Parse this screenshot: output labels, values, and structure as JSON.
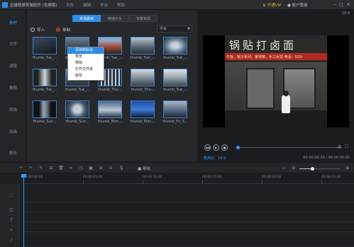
{
  "titlebar": {
    "title": "迅捷视频剪辑软件 (免费版)",
    "menus": [
      "文件",
      "编辑",
      "导出",
      "帮助"
    ],
    "vip_label": "开通VIP",
    "account_label": "账户登录",
    "icons": [
      "app-icon",
      "minimize-icon",
      "maximize-icon",
      "close-icon"
    ]
  },
  "sidebar": {
    "items": [
      {
        "label": "素材",
        "active": true
      },
      {
        "label": "文字",
        "active": false
      },
      {
        "label": "滤镜",
        "active": false
      },
      {
        "label": "叠附",
        "active": false
      },
      {
        "label": "转场",
        "active": false
      },
      {
        "label": "动画",
        "active": false
      },
      {
        "label": "配乐",
        "active": false
      }
    ]
  },
  "media": {
    "tabs": [
      {
        "label": "本地素材",
        "active": true
      },
      {
        "label": "精选片头",
        "active": false
      },
      {
        "label": "背景资源",
        "active": false
      }
    ],
    "import_label": "导入",
    "record_label": "录制",
    "filter_value": "所有",
    "thumbnails": [
      {
        "label": "thumb_Tue_..."
      },
      {
        "label": "thumb_Wed..."
      },
      {
        "label": "thumb_Tue_..."
      },
      {
        "label": "thumb_Tue_..."
      },
      {
        "label": "thumb_Tue_..."
      },
      {
        "label": "thumb_Tue_..."
      },
      {
        "label": "thumb_Tue_..."
      },
      {
        "label": "thumb_Thu..."
      },
      {
        "label": "thumb_Thu..."
      },
      {
        "label": "thumb_Tue_..."
      },
      {
        "label": "thumb_Sun..."
      },
      {
        "label": "thumb_Sun..."
      },
      {
        "label": "thumb_Mon..."
      },
      {
        "label": "thumb_Mon..."
      },
      {
        "label": "thumb_Fri_S..."
      }
    ],
    "context_menu": [
      "添加到轨道",
      "预览",
      "移除",
      "打开文件夹",
      "属性"
    ]
  },
  "preview": {
    "ratio_top": "16:9",
    "sign_big": "锅贴打卤面",
    "sign_small": "午饭、锅子系列、家常菜、手工水饺 电话：010-",
    "ratio_label": "宽高比：",
    "ratio_value": "16:9",
    "time": "00:00:00.00 / 00:00:05.00"
  },
  "timeline": {
    "export_label": "导出",
    "ruler": [
      "00:00:00.00",
      "00:00:05.00",
      "00:00:10.00",
      "00:00:15.00",
      "00:00:20.00",
      "00:00:25.00",
      "00:00:30.00"
    ],
    "zoom_level": 0.3
  },
  "colors": {
    "accent": "#2f8be6",
    "vip": "#e9b13a",
    "record": "#e05a2a"
  }
}
